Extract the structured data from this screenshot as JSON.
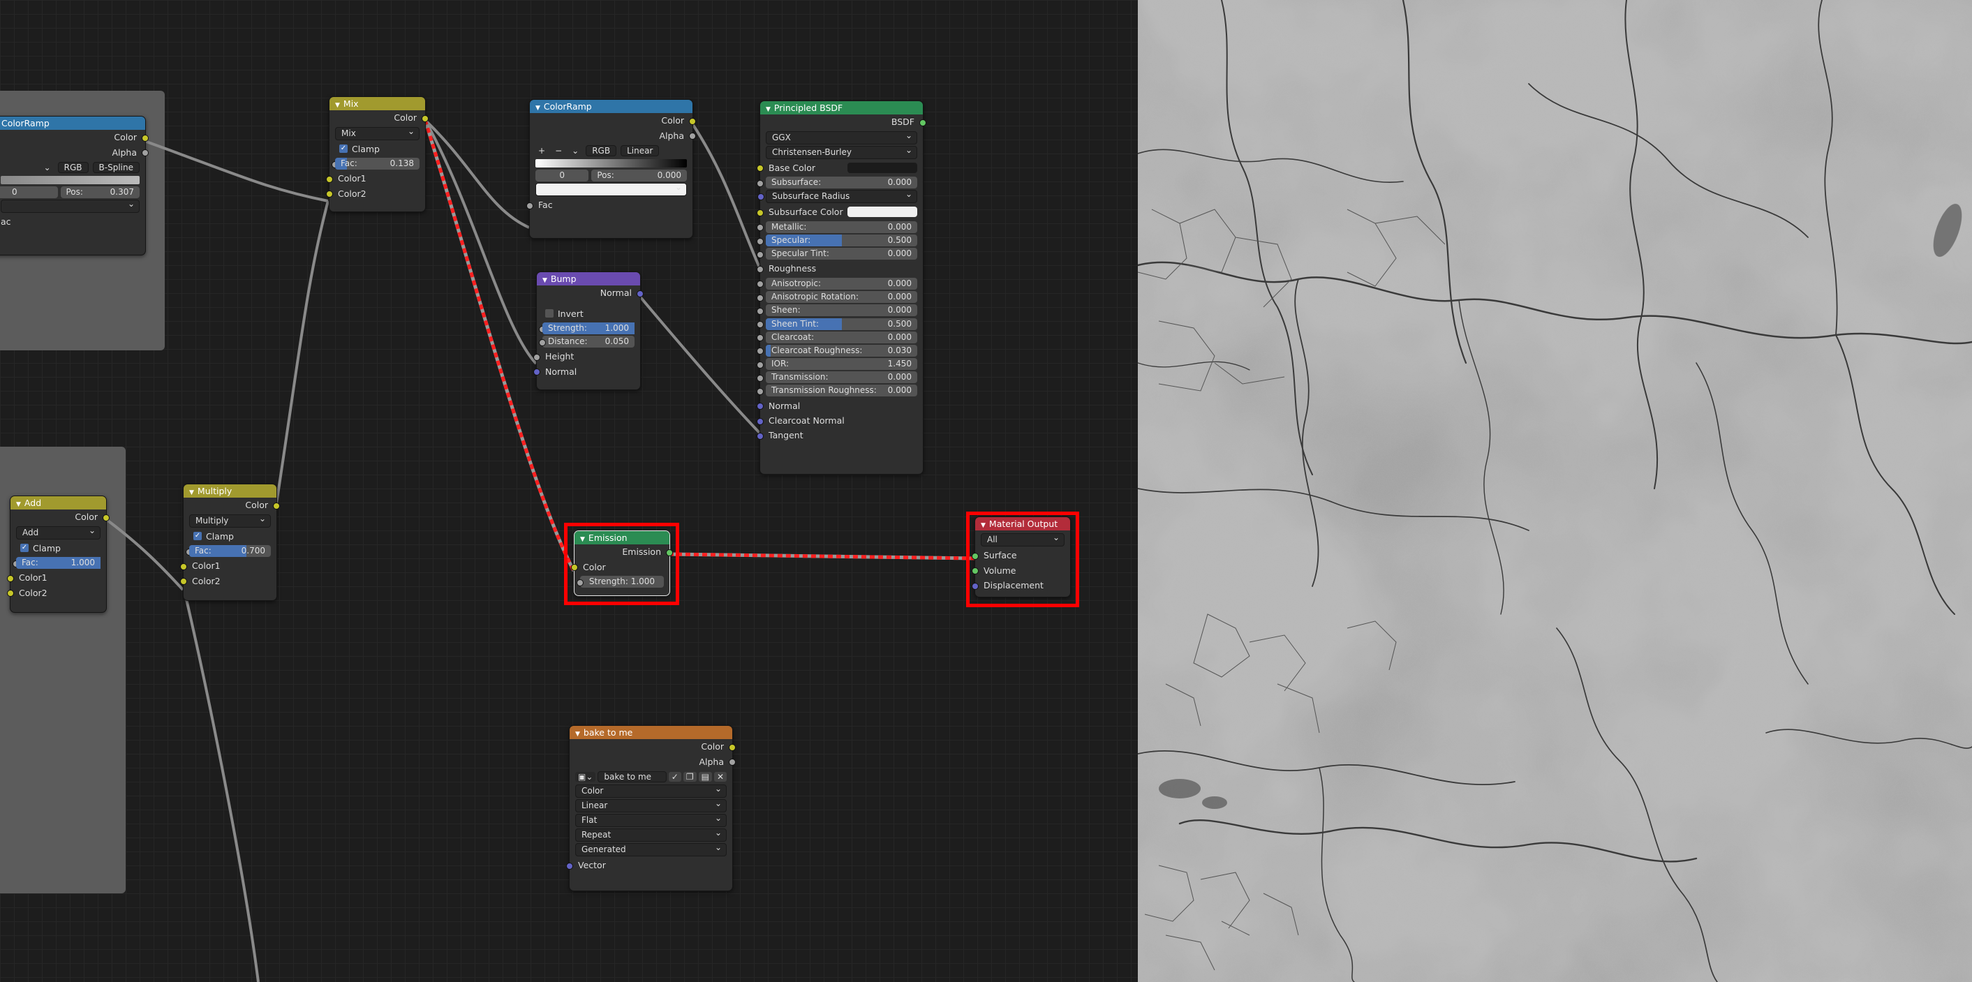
{
  "colors": {
    "accent_blue": "#4772b3",
    "highlight": "#ff0000",
    "socket_color": "#c7c729",
    "socket_float": "#a1a1a1",
    "socket_vector": "#6363c7",
    "socket_shader": "#63c763"
  },
  "nodes": {
    "colorramp_left": {
      "title": "ColorRamp",
      "out_color": "Color",
      "out_alpha": "Alpha",
      "mode": "RGB",
      "interp": "B-Spline",
      "index": "0",
      "pos_label": "Pos:",
      "pos_value": "0.307",
      "fac": "ac"
    },
    "mix": {
      "title": "Mix",
      "out_color": "Color",
      "blend": "Mix",
      "clamp": "Clamp",
      "fac_label": "Fac:",
      "fac_value": "0.138",
      "fac_fraction": 0.138,
      "in1": "Color1",
      "in2": "Color2"
    },
    "colorramp": {
      "title": "ColorRamp",
      "out_color": "Color",
      "out_alpha": "Alpha",
      "plus": "+",
      "minus": "−",
      "chev": "⌄",
      "mode": "RGB",
      "interp": "Linear",
      "index": "0",
      "pos_label": "Pos:",
      "pos_value": "0.000",
      "fac": "Fac"
    },
    "bump": {
      "title": "Bump",
      "out_normal": "Normal",
      "invert": "Invert",
      "strength_label": "Strength:",
      "strength_value": "1.000",
      "strength_fraction": 1.0,
      "distance_label": "Distance:",
      "distance_value": "0.050",
      "height": "Height",
      "normal": "Normal"
    },
    "bsdf": {
      "title": "Principled BSDF",
      "out": "BSDF",
      "distribution": "GGX",
      "sss_method": "Christensen-Burley",
      "base_color": "Base Color",
      "rows": [
        {
          "label": "Subsurface:",
          "value": "0.000",
          "fill": 0
        },
        {
          "label": "Subsurface Radius",
          "value": "",
          "dropdown": true
        },
        {
          "label": "Subsurface Color",
          "swatch": "#f0f0f0"
        },
        {
          "label": "Metallic:",
          "value": "0.000",
          "fill": 0
        },
        {
          "label": "Specular:",
          "value": "0.500",
          "fill": 0.5
        },
        {
          "label": "Specular Tint:",
          "value": "0.000",
          "fill": 0
        },
        {
          "label": "Roughness",
          "value": "",
          "plain": true
        },
        {
          "label": "Anisotropic:",
          "value": "0.000",
          "fill": 0
        },
        {
          "label": "Anisotropic Rotation:",
          "value": "0.000",
          "fill": 0
        },
        {
          "label": "Sheen:",
          "value": "0.000",
          "fill": 0
        },
        {
          "label": "Sheen Tint:",
          "value": "0.500",
          "fill": 0.5
        },
        {
          "label": "Clearcoat:",
          "value": "0.000",
          "fill": 0
        },
        {
          "label": "Clearcoat Roughness:",
          "value": "0.030",
          "fill": 0.03
        },
        {
          "label": "IOR:",
          "value": "1.450",
          "fill": 0
        },
        {
          "label": "Transmission:",
          "value": "0.000",
          "fill": 0
        },
        {
          "label": "Transmission Roughness:",
          "value": "0.000",
          "fill": 0
        }
      ],
      "normal": "Normal",
      "clearcoat_normal": "Clearcoat Normal",
      "tangent": "Tangent"
    },
    "emission": {
      "title": "Emission",
      "out": "Emission",
      "color": "Color",
      "strength_label": "Strength:",
      "strength_value": "1.000"
    },
    "output": {
      "title": "Material Output",
      "target": "All",
      "surface": "Surface",
      "volume": "Volume",
      "displacement": "Displacement"
    },
    "add": {
      "title": "Add",
      "out_color": "Color",
      "blend": "Add",
      "clamp": "Clamp",
      "fac_label": "Fac:",
      "fac_value": "1.000",
      "fac_fraction": 1.0,
      "in1": "Color1",
      "in2": "Color2"
    },
    "multiply": {
      "title": "Multiply",
      "out_color": "Color",
      "blend": "Multiply",
      "clamp": "Clamp",
      "fac_label": "Fac:",
      "fac_value": "0.700",
      "fac_fraction": 0.7,
      "in1": "Color1",
      "in2": "Color2"
    },
    "image": {
      "title": "bake to me",
      "out_color": "Color",
      "out_alpha": "Alpha",
      "image_name": "bake to me",
      "color_space": "Color",
      "interpolation": "Linear",
      "projection": "Flat",
      "extension": "Repeat",
      "source": "Generated",
      "vector": "Vector"
    }
  }
}
